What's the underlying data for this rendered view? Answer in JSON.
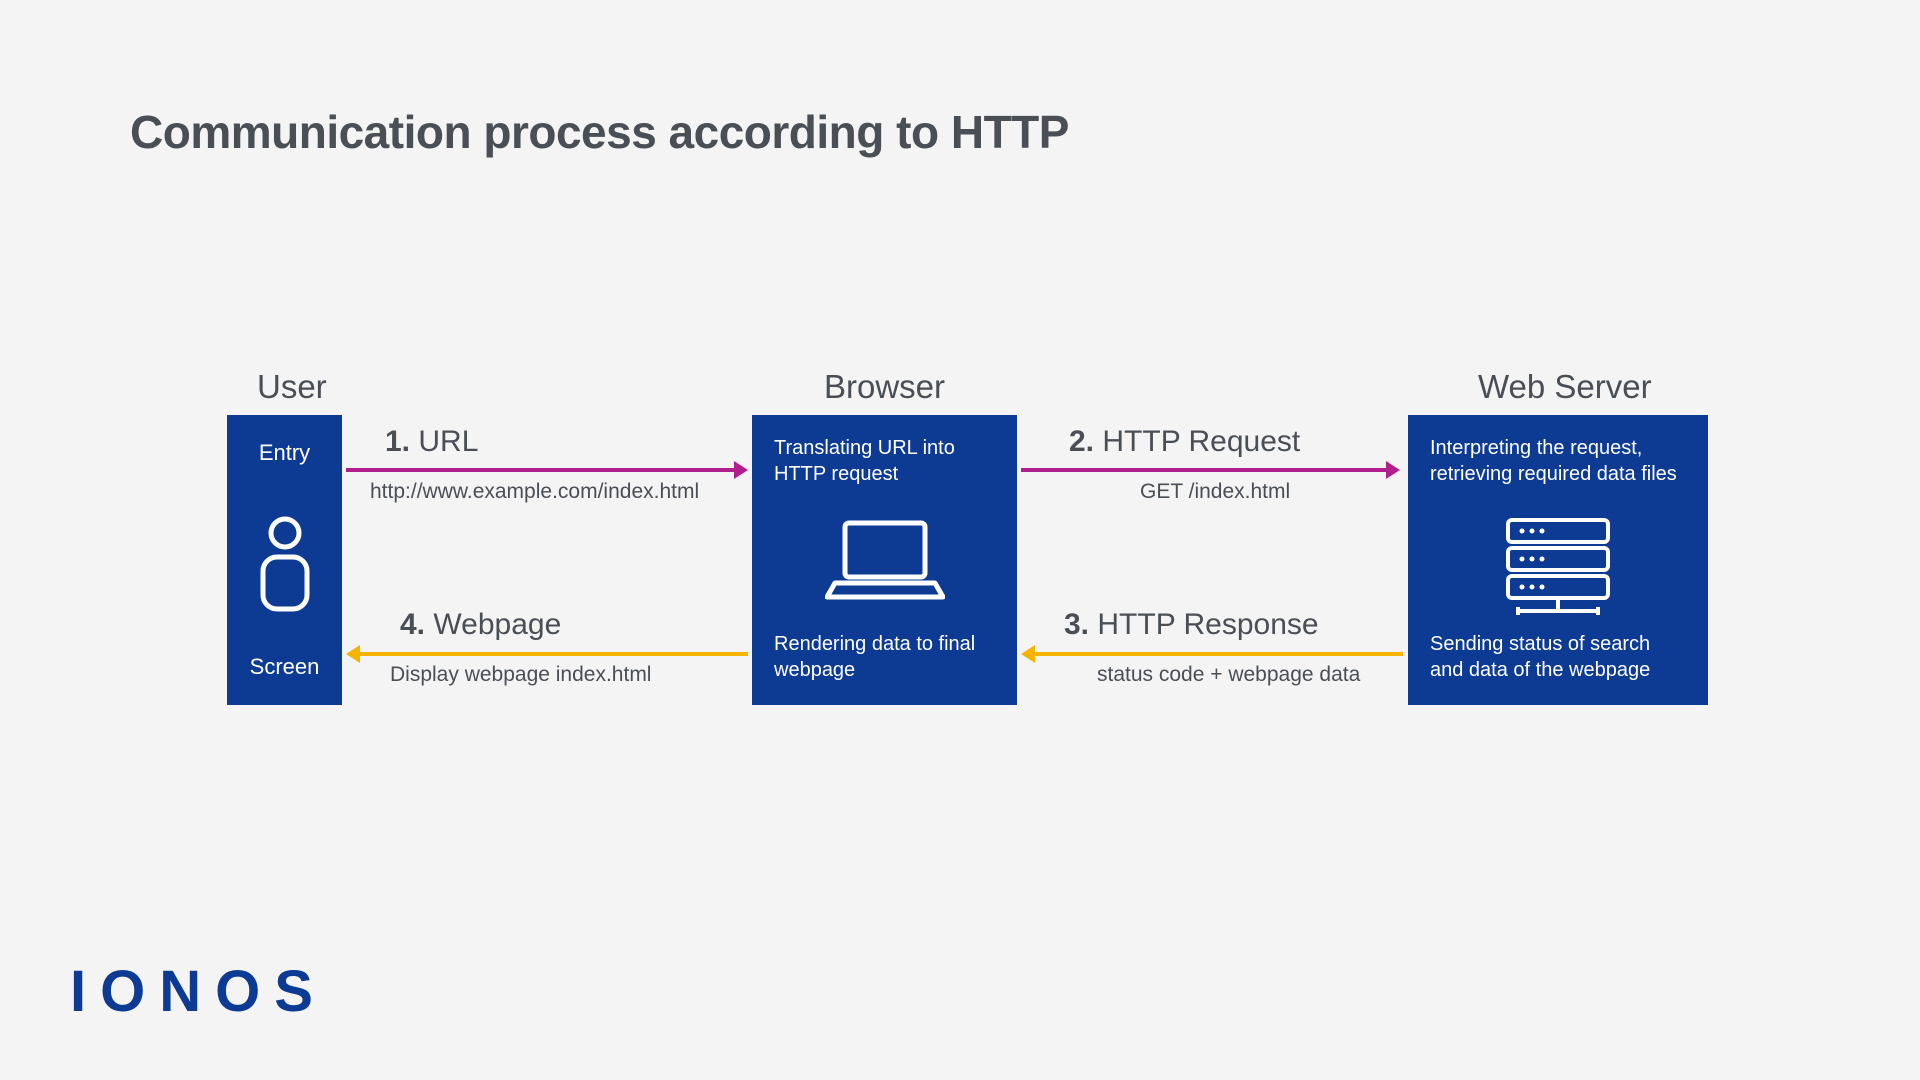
{
  "title": "Communication process according to HTTP",
  "columns": {
    "user": "User",
    "browser": "Browser",
    "server": "Web Server"
  },
  "user_box": {
    "entry": "Entry",
    "screen": "Screen"
  },
  "browser_box": {
    "top": "Translating URL into HTTP request",
    "bottom": "Rendering data to final webpage"
  },
  "server_box": {
    "top": "Interpreting the request, retrieving required data files",
    "bottom": "Sending status of search and data of the webpage"
  },
  "steps": {
    "s1": {
      "num": "1.",
      "label": "URL",
      "sub": "http://www.example.com/index.html"
    },
    "s2": {
      "num": "2.",
      "label": "HTTP Request",
      "sub": "GET /index.html"
    },
    "s3": {
      "num": "3.",
      "label": "HTTP Response",
      "sub": "status code + webpage data"
    },
    "s4": {
      "num": "4.",
      "label": "Webpage",
      "sub": "Display webpage index.html"
    }
  },
  "brand": "IONOS",
  "colors": {
    "box": "#0d3a93",
    "magenta": "#b11e8e",
    "amber": "#f5b400"
  }
}
